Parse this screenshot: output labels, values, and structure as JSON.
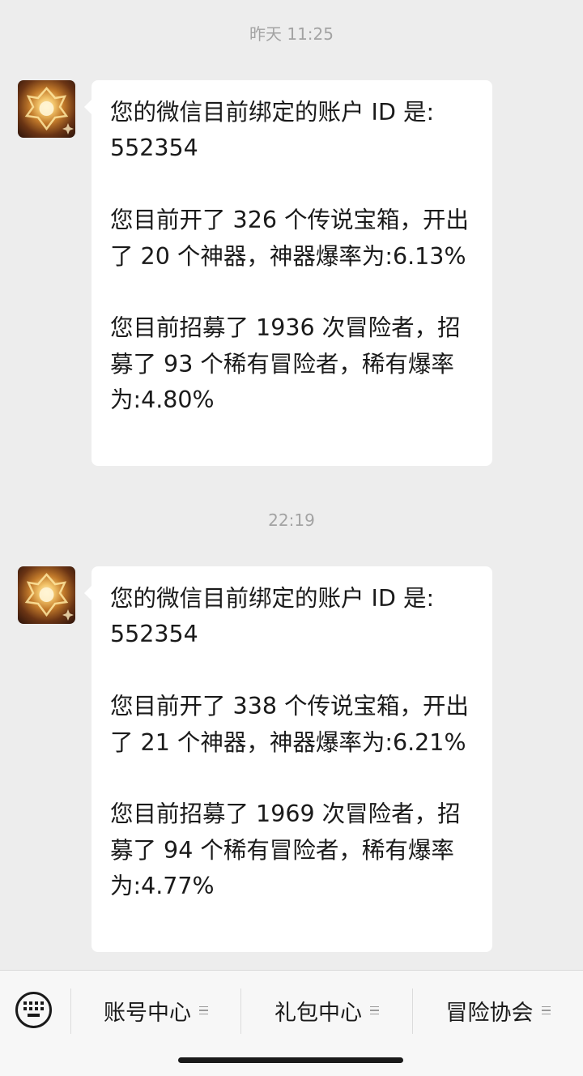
{
  "messages": [
    {
      "time": "昨天 11:25",
      "lines": [
        "您的微信目前绑定的账户 ID 是:",
        "552354",
        "",
        "您目前开了 326 个传说宝箱，开出",
        "了 20 个神器，神器爆率为:6.13%",
        "",
        "您目前招募了 1936 次冒险者，招",
        "募了 93 个稀有冒险者，稀有爆率",
        "为:4.80%"
      ]
    },
    {
      "time": "22:19",
      "lines": [
        "您的微信目前绑定的账户 ID 是:",
        "552354",
        "",
        "您目前开了 338 个传说宝箱，开出",
        "了 21 个神器，神器爆率为:6.21%",
        "",
        "您目前招募了 1969 次冒险者，招",
        "募了 94 个稀有冒险者，稀有爆率",
        "为:4.77%"
      ]
    }
  ],
  "bottom_menu": {
    "keyboard_icon": "keyboard-icon",
    "items": [
      {
        "label": "账号中心",
        "icon": "menu-list-icon"
      },
      {
        "label": "礼包中心",
        "icon": "menu-list-icon"
      },
      {
        "label": "冒险协会",
        "icon": "menu-list-icon"
      }
    ]
  }
}
